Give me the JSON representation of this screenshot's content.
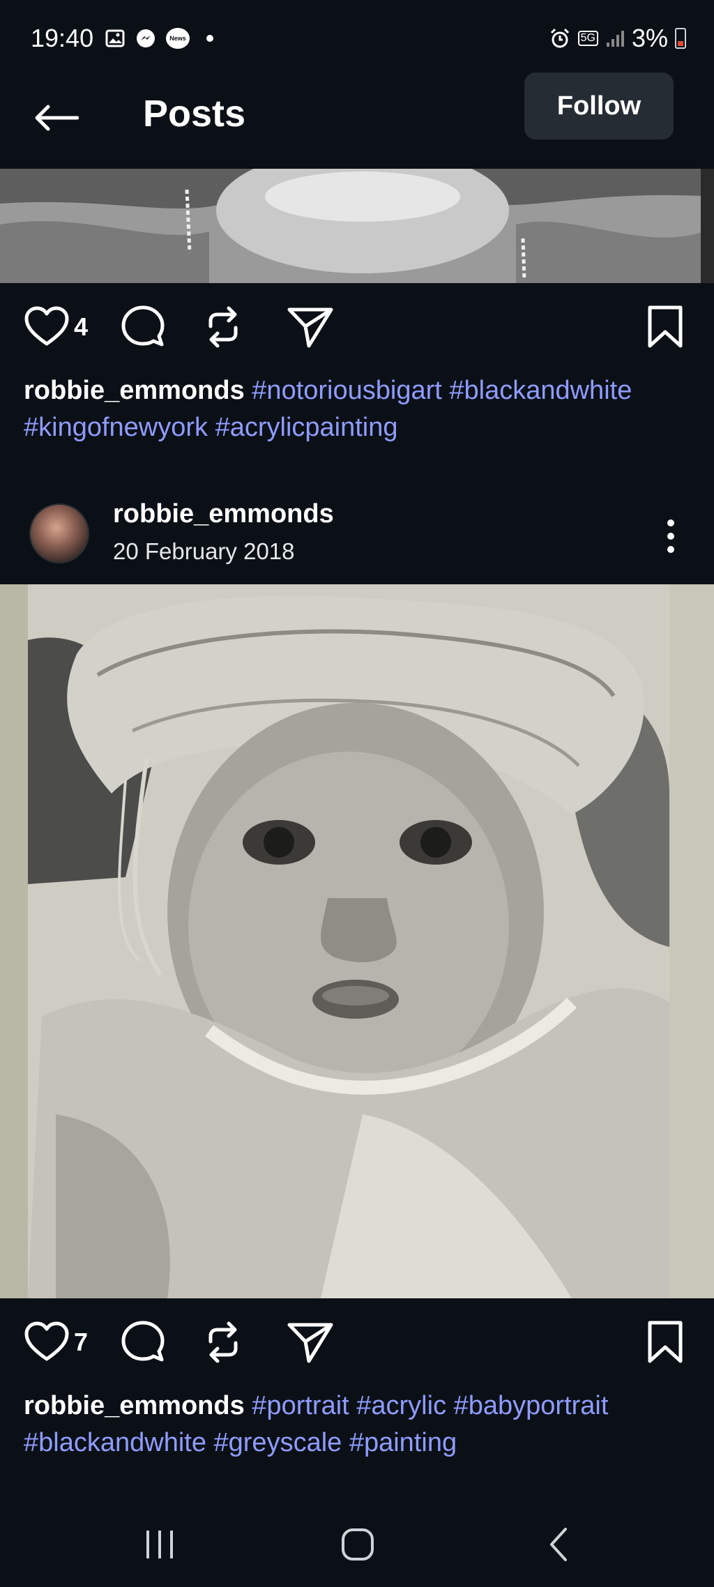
{
  "status_bar": {
    "time": "19:40",
    "battery_percent": "3%",
    "network_badge": "5G",
    "notification_icons": [
      "gallery-icon",
      "messenger-icon",
      "news-icon",
      "dot-icon"
    ],
    "news_label": "News"
  },
  "app_bar": {
    "title": "Posts",
    "follow_label": "Follow"
  },
  "posts": [
    {
      "likes": "4",
      "caption_user": "robbie_emmonds",
      "caption_tags": "#notoriousbigart #blackandwhite #kingofnewyork #acrylicpainting"
    },
    {
      "author": "robbie_emmonds",
      "date": "20 February 2018",
      "likes": "7",
      "caption_user": "robbie_emmonds",
      "caption_tags": "#portrait #acrylic #babyportrait #blackandwhite #greyscale #painting"
    }
  ],
  "colors": {
    "background": "#0b1017",
    "hashtag": "#8f9cff",
    "follow_button": "#262c34"
  }
}
